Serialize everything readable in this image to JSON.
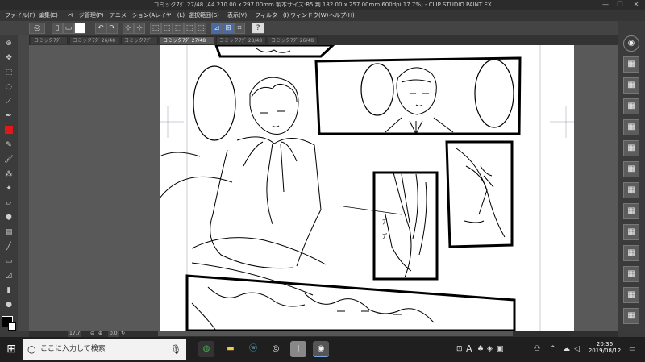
{
  "window": {
    "title": "コミック7ﾀﾞ 27/48 (A4 210.00 x 297.00mm 製本サイズ:B5 判 182.00 x 257.00mm 600dpi 17.7%) - CLIP STUDIO PAINT EX",
    "minimize": "—",
    "maximize": "❐",
    "close": "✕"
  },
  "menu": {
    "items": [
      "ファイル(F)",
      "編集(E)",
      "ページ管理(P)",
      "アニメーション(A)",
      "レイヤー(L)",
      "選択範囲(S)",
      "表示(V)",
      "フィルター(I)",
      "ウィンドウ(W)",
      "ヘルプ(H)"
    ]
  },
  "tabs": [
    {
      "label": "コミック7ﾀﾞ"
    },
    {
      "label": "コミック7ﾀﾞ 26/48"
    },
    {
      "label": "コミック7ﾀﾞ"
    },
    {
      "label": "コミック7ﾀﾞ 27/48"
    },
    {
      "label": "コミック7ﾀﾞ 28/48"
    },
    {
      "label": "コミック7ﾀﾞ 26/48"
    }
  ],
  "command_bar": {
    "help_label": "?"
  },
  "status": {
    "zoom": "17.7",
    "angle": "0.0"
  },
  "taskbar": {
    "start": "⊞",
    "search_placeholder": "ここに入力して検索",
    "app_letter_a": "A",
    "clock_time": "20:36",
    "clock_date": "2019/08/12"
  },
  "colors": {
    "main": "#000000",
    "sub": "#ffffff",
    "accent_red": "#e01818"
  },
  "icons": {
    "left_tools": [
      "zoom-icon",
      "move-icon",
      "select-icon",
      "lasso-icon",
      "eyedropper-icon",
      "pen-icon",
      "pencil-icon",
      "brush-icon",
      "airbrush-icon",
      "eraser-icon",
      "fill-icon",
      "gradient-icon",
      "figure-icon",
      "text-icon"
    ]
  }
}
